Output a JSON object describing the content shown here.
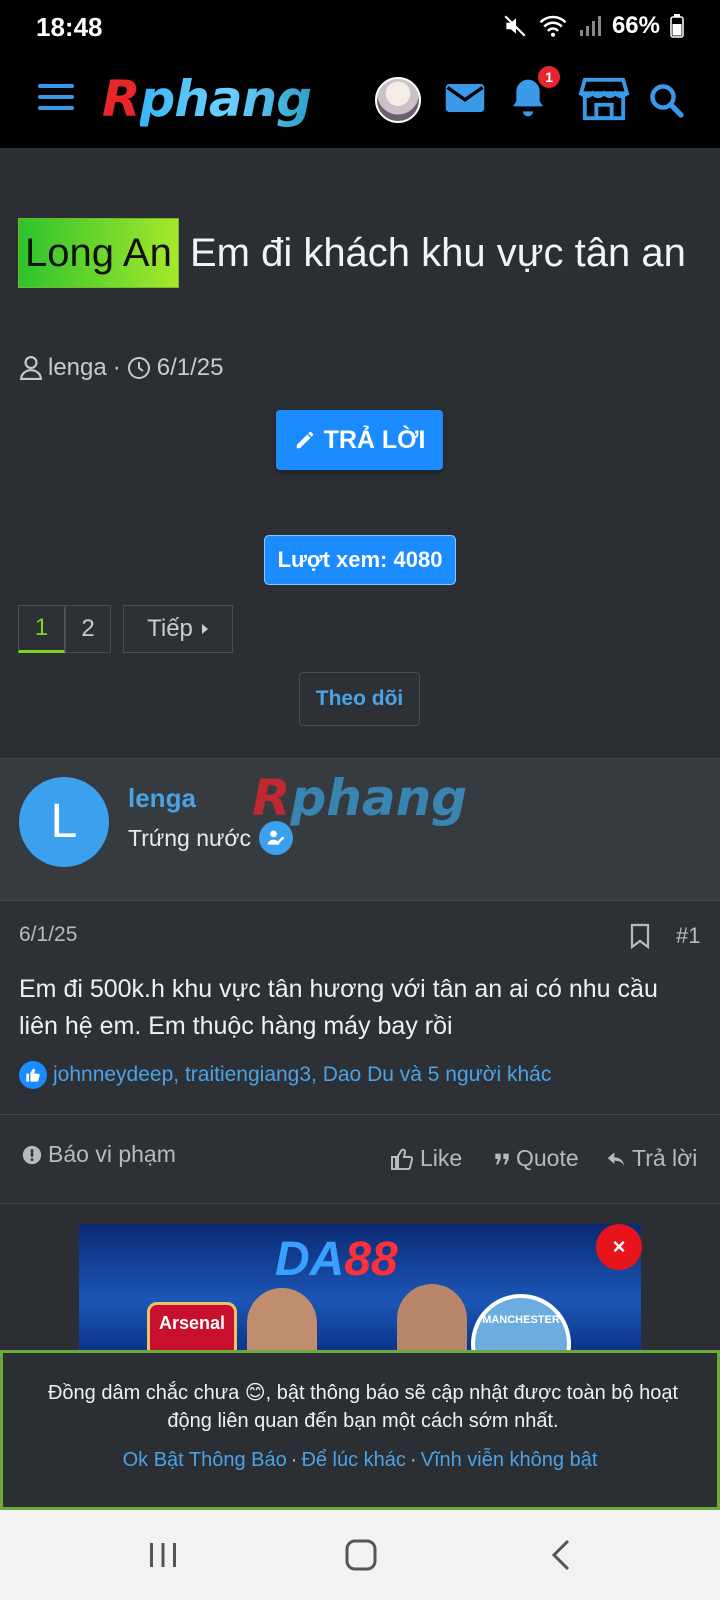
{
  "status_bar": {
    "time": "18:48",
    "battery": "66%"
  },
  "header": {
    "logo_first": "R",
    "logo_rest": "phang",
    "notification_count": "1"
  },
  "thread": {
    "prefix": "Long An",
    "title": "Em đi khách khu vực tân an",
    "author": "lenga",
    "meta_sep": "·",
    "date": "6/1/25",
    "reply_button": "TRẢ LỜI",
    "views": "Lượt xem: 4080",
    "pages": [
      "1",
      "2"
    ],
    "next_label": "Tiếp",
    "follow_label": "Theo dõi"
  },
  "post": {
    "avatar_letter": "L",
    "username": "lenga",
    "user_title": "Trứng nước",
    "watermark_first": "R",
    "watermark_rest": "phang",
    "date": "6/1/25",
    "number": "#1",
    "message": "Em đi 500k.h khu vực tân hương với tân an ai có nhu cầu liên hệ em. Em thuộc hàng máy bay rồi",
    "reactions": "johnneydeep, traitiengiang3, Dao Du và 5 người khác",
    "actions": {
      "report": "Báo vi phạm",
      "like": "Like",
      "quote": "Quote",
      "reply": "Trả lời"
    }
  },
  "ad": {
    "brand_a": "DA",
    "brand_b": "88",
    "club_left": "Arsenal",
    "club_right": "MANCHESTER",
    "close": "×"
  },
  "notification_prompt": {
    "message": "Đồng dâm chắc chưa 😊, bật thông báo sẽ cập nhật được toàn bộ hoạt động liên quan đến bạn một cách sớm nhất.",
    "link_ok": "Ok Bật Thông Báo",
    "link_later": "Để lúc khác",
    "link_never": "Vĩnh viễn không bật",
    "sep": "·"
  },
  "colors": {
    "accent": "#1a8cff",
    "link": "#4ba3e6",
    "prefix_green": "#2ec32e",
    "badge_red": "#e4262d",
    "background": "#2b2f33"
  },
  "icons": [
    "menu-icon",
    "mail-icon",
    "bell-icon",
    "store-icon",
    "search-icon",
    "user-icon",
    "clock-icon",
    "pencil-icon",
    "bookmark-icon",
    "like-icon",
    "quote-icon",
    "reply-icon",
    "alert-icon"
  ]
}
